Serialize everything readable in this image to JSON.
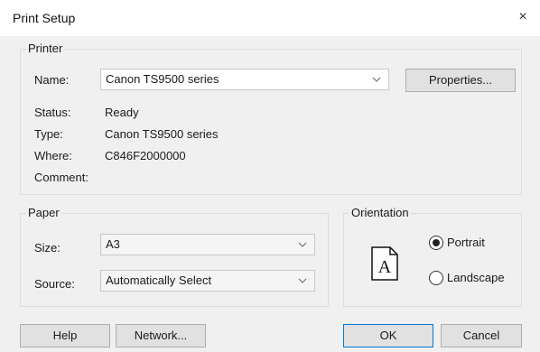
{
  "window": {
    "title": "Print Setup",
    "close_glyph": "×"
  },
  "printer": {
    "legend": "Printer",
    "name_label": "Name:",
    "name_value": "Canon TS9500 series",
    "properties_label": "Properties...",
    "status_label": "Status:",
    "status_value": "Ready",
    "type_label": "Type:",
    "type_value": "Canon TS9500 series",
    "where_label": "Where:",
    "where_value": "C846F2000000",
    "comment_label": "Comment:",
    "comment_value": ""
  },
  "paper": {
    "legend": "Paper",
    "size_label": "Size:",
    "size_value": "A3",
    "source_label": "Source:",
    "source_value": "Automatically Select"
  },
  "orientation": {
    "legend": "Orientation",
    "preview_glyph": "A",
    "portrait_label": "Portrait",
    "landscape_label": "Landscape",
    "selected": "Portrait"
  },
  "buttons": {
    "help": "Help",
    "network": "Network...",
    "ok": "OK",
    "cancel": "Cancel"
  },
  "icons": [
    "close-icon",
    "chevron-down-icon",
    "page-portrait-icon"
  ]
}
